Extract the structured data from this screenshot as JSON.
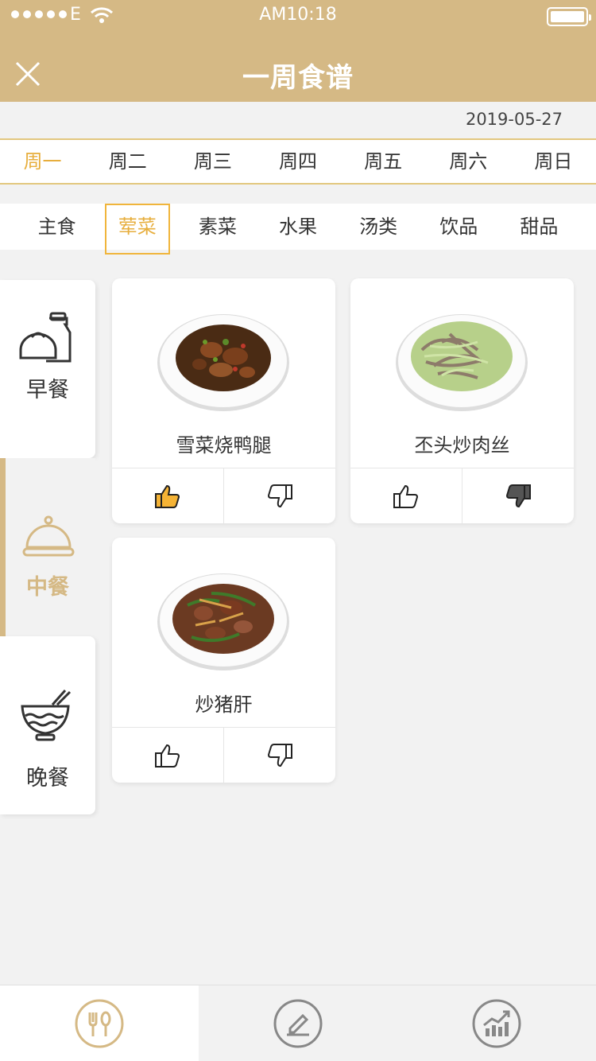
{
  "status": {
    "carrier": "E",
    "time": "AM10:18"
  },
  "nav": {
    "title": "一周食谱"
  },
  "date": "2019-05-27",
  "weekdays": [
    "周一",
    "周二",
    "周三",
    "周四",
    "周五",
    "周六",
    "周日"
  ],
  "active_weekday": "周一",
  "categories": [
    "主食",
    "荤菜",
    "素菜",
    "水果",
    "汤类",
    "饮品",
    "甜品"
  ],
  "active_category": "荤菜",
  "meals": {
    "breakfast": "早餐",
    "lunch": "中餐",
    "dinner": "晚餐",
    "active": "中餐"
  },
  "dishes": [
    {
      "name": "雪菜烧鸭腿",
      "liked": true,
      "disliked": false
    },
    {
      "name": "丕头炒肉丝",
      "liked": false,
      "disliked": true
    },
    {
      "name": "炒猪肝",
      "liked": false,
      "disliked": false
    }
  ],
  "tabs": [
    {
      "icon": "fork-spoon-icon",
      "active": true
    },
    {
      "icon": "edit-icon",
      "active": false
    },
    {
      "icon": "chart-icon",
      "active": false
    }
  ],
  "colors": {
    "brand": "#d5b985",
    "accent": "#e7ae3d",
    "like": "#f5b335",
    "dislike": "#555555"
  }
}
